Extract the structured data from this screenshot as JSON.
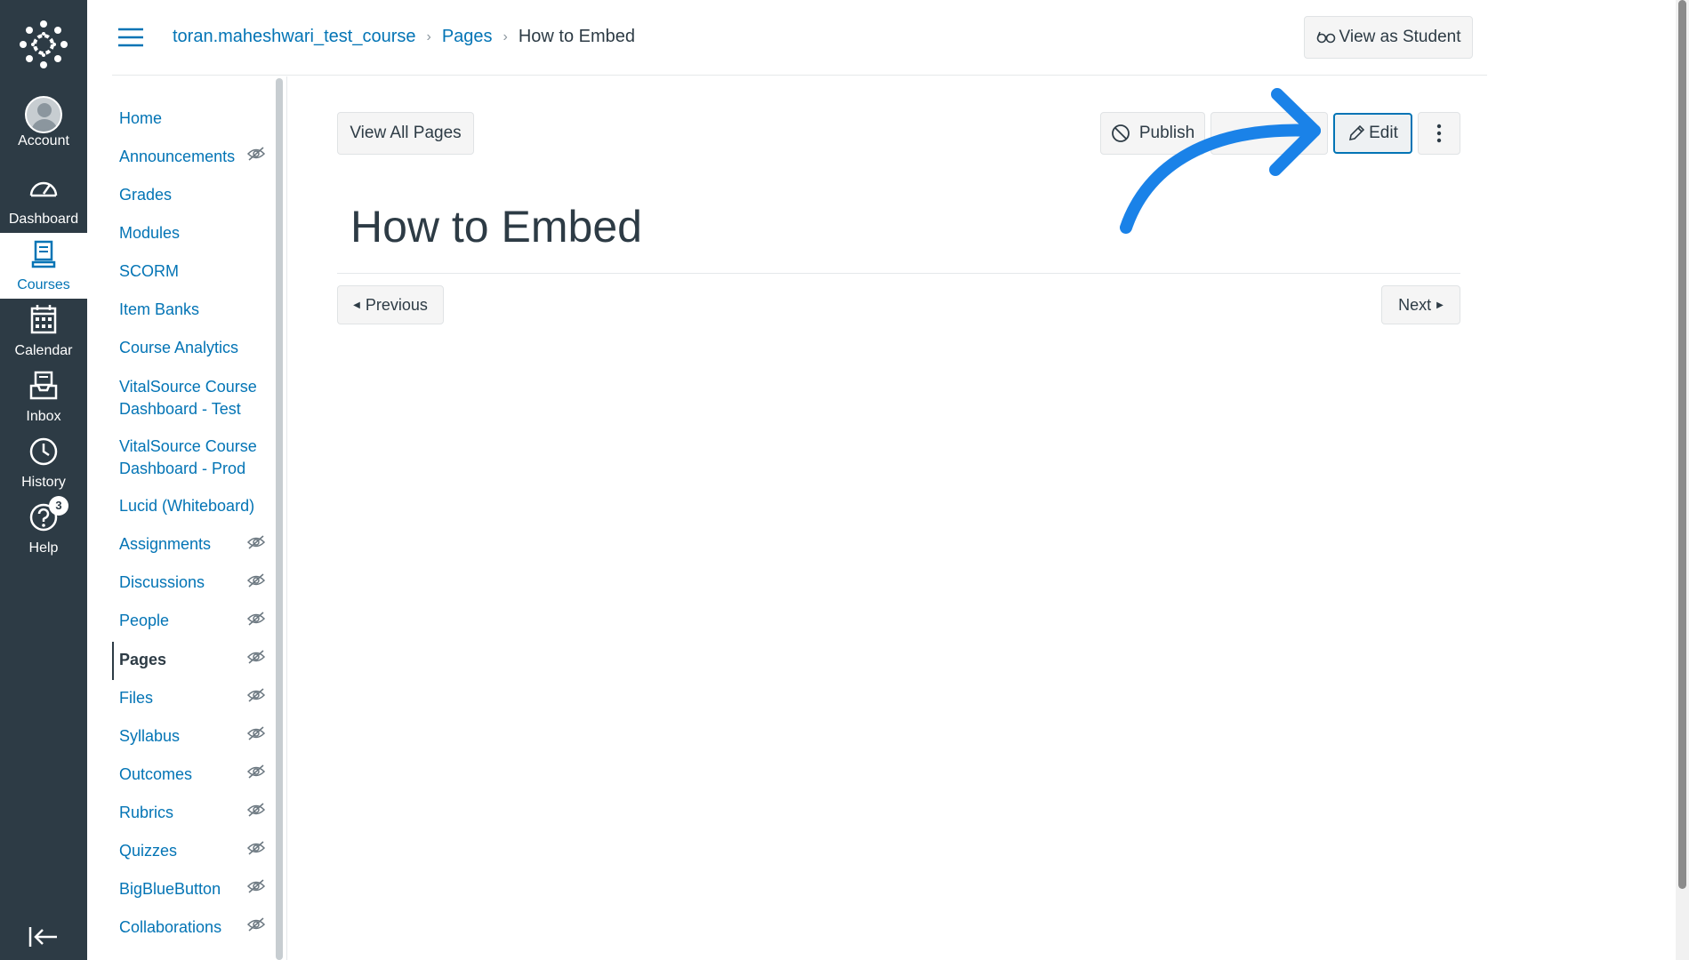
{
  "global_nav": {
    "items": [
      {
        "label": "Account",
        "icon": "avatar"
      },
      {
        "label": "Dashboard",
        "icon": "dashboard-icon"
      },
      {
        "label": "Courses",
        "icon": "courses-icon",
        "active": true
      },
      {
        "label": "Calendar",
        "icon": "calendar-icon"
      },
      {
        "label": "Inbox",
        "icon": "inbox-icon"
      },
      {
        "label": "History",
        "icon": "history-icon"
      },
      {
        "label": "Help",
        "icon": "help-icon",
        "badge": "3"
      }
    ]
  },
  "breadcrumb": {
    "course": "toran.maheshwari_test_course",
    "section": "Pages",
    "current": "How to Embed"
  },
  "header": {
    "view_as_student": "View as Student"
  },
  "course_nav": {
    "items": [
      {
        "label": "Home"
      },
      {
        "label": "Announcements",
        "hidden": true
      },
      {
        "label": "Grades"
      },
      {
        "label": "Modules"
      },
      {
        "label": "SCORM"
      },
      {
        "label": "Item Banks"
      },
      {
        "label": "Course Analytics"
      },
      {
        "label": "VitalSource Course Dashboard - Test"
      },
      {
        "label": "VitalSource Course Dashboard - Prod"
      },
      {
        "label": "Lucid (Whiteboard)"
      },
      {
        "label": "Assignments",
        "hidden": true
      },
      {
        "label": "Discussions",
        "hidden": true
      },
      {
        "label": "People",
        "hidden": true
      },
      {
        "label": "Pages",
        "hidden": true,
        "active": true
      },
      {
        "label": "Files",
        "hidden": true
      },
      {
        "label": "Syllabus",
        "hidden": true
      },
      {
        "label": "Outcomes",
        "hidden": true
      },
      {
        "label": "Rubrics",
        "hidden": true
      },
      {
        "label": "Quizzes",
        "hidden": true
      },
      {
        "label": "BigBlueButton",
        "hidden": true
      },
      {
        "label": "Collaborations",
        "hidden": true
      }
    ]
  },
  "toolbar": {
    "view_all_pages": "View All Pages",
    "publish": "Publish",
    "edit": "Edit"
  },
  "page": {
    "title": "How to Embed",
    "previous": "Previous",
    "next": "Next"
  },
  "colors": {
    "nav_bg": "#2d3b45",
    "link": "#0374b5",
    "annotation_arrow": "#1a82e8"
  }
}
